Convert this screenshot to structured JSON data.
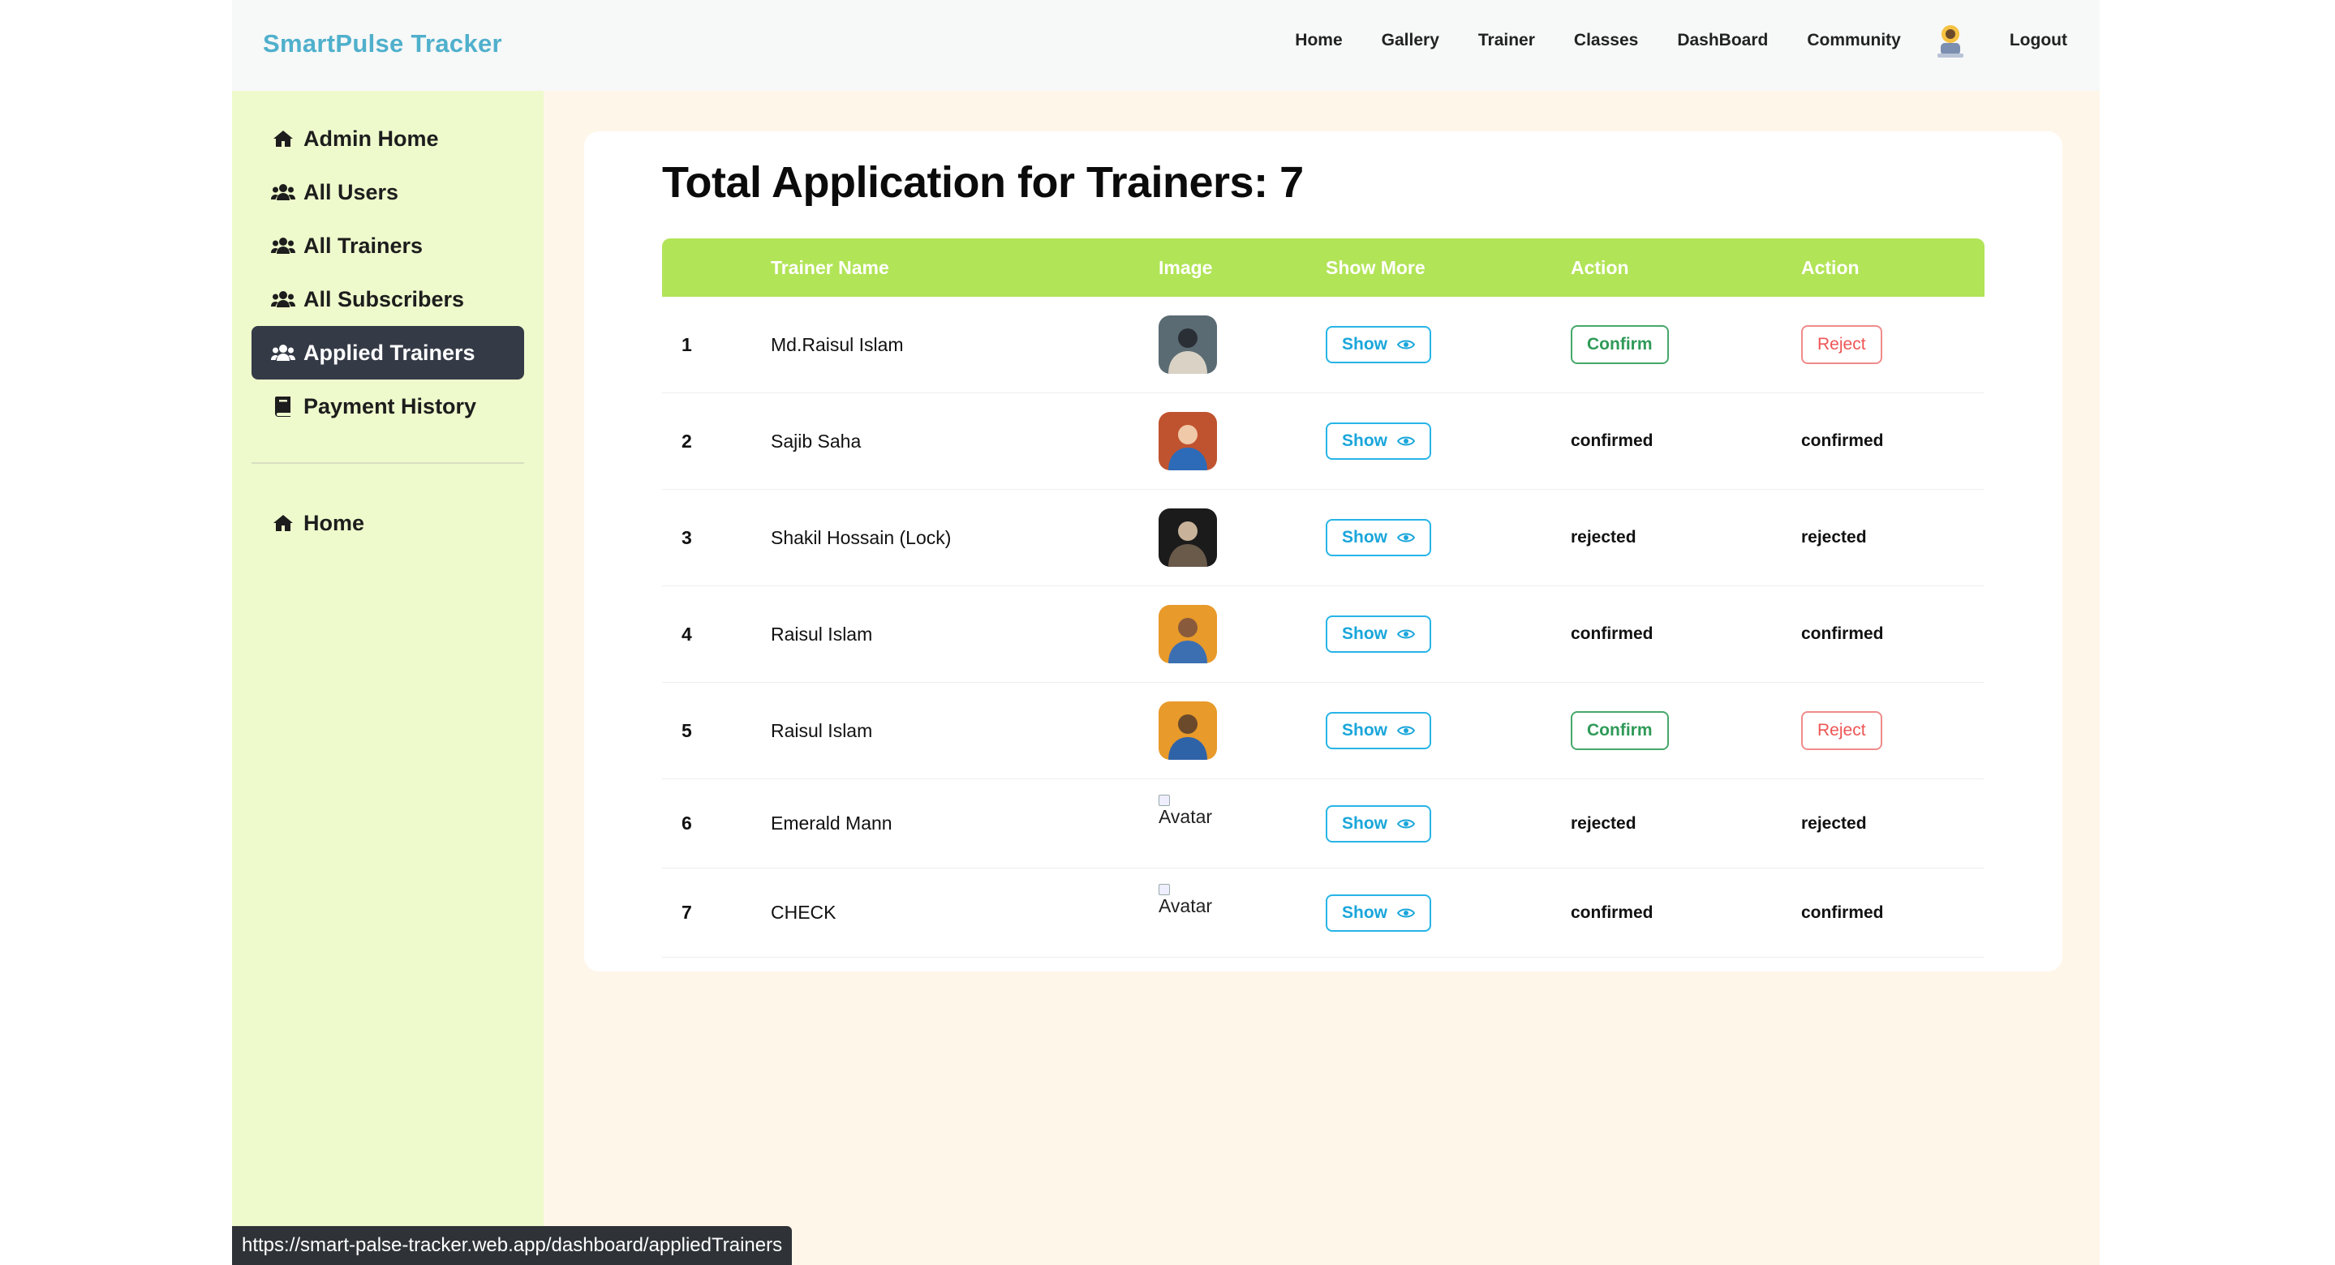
{
  "app": {
    "brand": "SmartPulse Tracker"
  },
  "nav": {
    "items": [
      {
        "label": "Home",
        "name": "nav-home"
      },
      {
        "label": "Gallery",
        "name": "nav-gallery"
      },
      {
        "label": "Trainer",
        "name": "nav-trainer"
      },
      {
        "label": "Classes",
        "name": "nav-classes"
      },
      {
        "label": "DashBoard",
        "name": "nav-dashboard"
      },
      {
        "label": "Community",
        "name": "nav-community"
      }
    ],
    "logout": "Logout"
  },
  "sidebar": {
    "items": [
      {
        "label": "Admin Home",
        "icon": "home-icon",
        "active": false
      },
      {
        "label": "All Users",
        "icon": "users-icon",
        "active": false
      },
      {
        "label": "All Trainers",
        "icon": "users-icon",
        "active": false
      },
      {
        "label": "All Subscribers",
        "icon": "users-icon",
        "active": false
      },
      {
        "label": "Applied Trainers",
        "icon": "users-icon",
        "active": true
      },
      {
        "label": "Payment History",
        "icon": "book-icon",
        "active": false
      }
    ],
    "secondary": [
      {
        "label": "Home",
        "icon": "home-icon"
      }
    ]
  },
  "main": {
    "title": "Total Application for Trainers: 7",
    "columns": [
      "",
      "Trainer Name",
      "Image",
      "Show More",
      "Action",
      "Action"
    ],
    "show_label": "Show",
    "confirm_label": "Confirm",
    "reject_label": "Reject",
    "broken_image_alt": "Avatar",
    "rows": [
      {
        "index": "1",
        "name": "Md.Raisul Islam",
        "image": "photo",
        "status": "pending"
      },
      {
        "index": "2",
        "name": "Sajib Saha",
        "image": "photo",
        "status": "confirmed"
      },
      {
        "index": "3",
        "name": "Shakil Hossain (Lock)",
        "image": "photo",
        "status": "rejected"
      },
      {
        "index": "4",
        "name": "Raisul Islam",
        "image": "photo",
        "status": "confirmed"
      },
      {
        "index": "5",
        "name": "Raisul Islam",
        "image": "photo",
        "status": "pending"
      },
      {
        "index": "6",
        "name": "Emerald Mann",
        "image": "broken",
        "status": "rejected"
      },
      {
        "index": "7",
        "name": "CHECK",
        "image": "broken",
        "status": "confirmed"
      }
    ]
  },
  "statusbar": {
    "url": "https://smart-palse-tracker.web.app/dashboard/appliedTrainers"
  },
  "colors": {
    "brand": "#4fb0cc",
    "table_header": "#b2e457",
    "sidebar_bg": "#eefacc",
    "active_item": "#343a46",
    "content_bg": "#fff6ea",
    "show": "#27b4e6",
    "confirm": "#46a86a",
    "reject": "#ef5454"
  }
}
